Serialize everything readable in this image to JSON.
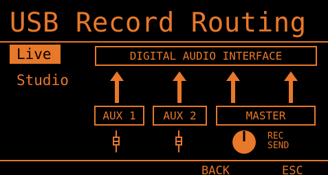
{
  "header": {
    "title": "USB Record Routing"
  },
  "sidebar": {
    "items": [
      {
        "label": "Live",
        "active": true
      },
      {
        "label": "Studio",
        "active": false
      }
    ]
  },
  "routing": {
    "interface_label": "DIGITAL AUDIO INTERFACE",
    "sources": [
      {
        "label": "AUX 1"
      },
      {
        "label": "AUX 2"
      },
      {
        "label": "MASTER"
      }
    ],
    "master_control": {
      "line1": "REC",
      "line2": "SEND",
      "icon": "knob-icon"
    }
  },
  "softkeys": {
    "back": "BACK",
    "esc": "ESC"
  },
  "colors": {
    "accent": "#e8782a",
    "background": "#000000"
  }
}
